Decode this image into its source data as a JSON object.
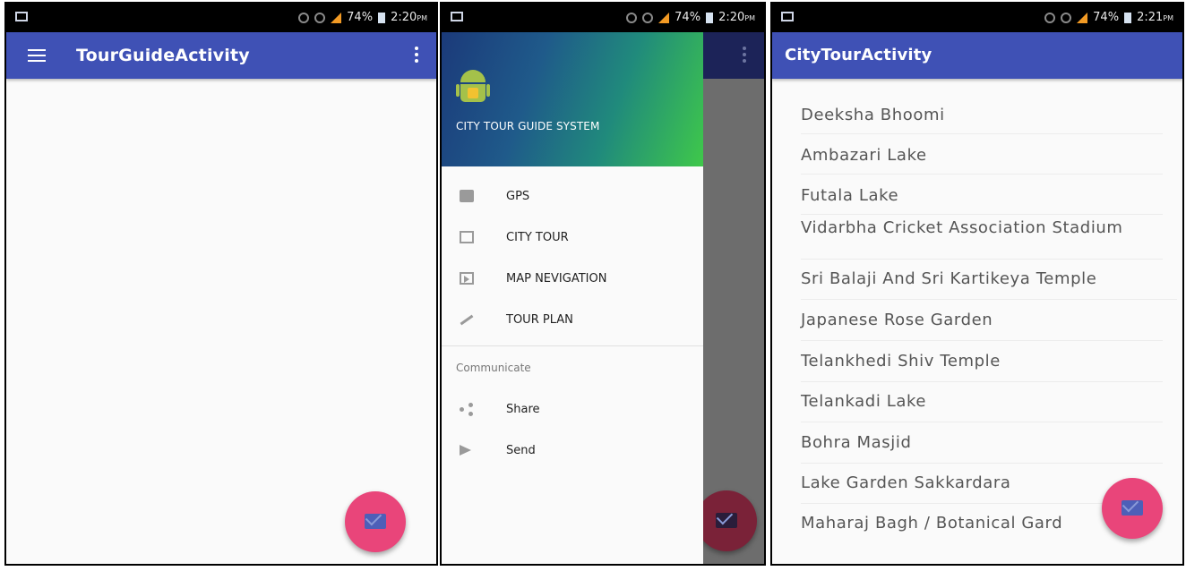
{
  "status_bar": {
    "battery": "74%",
    "time_1": "2:20",
    "time_2": "2:20",
    "time_3": "2:21",
    "ampm": "PM"
  },
  "screen1": {
    "title": "TourGuideActivity"
  },
  "screen2": {
    "drawer_title": "CITY TOUR GUIDE SYSTEM",
    "items": [
      {
        "label": "GPS",
        "icon": "camera-icon"
      },
      {
        "label": "CITY TOUR",
        "icon": "image-icon"
      },
      {
        "label": "MAP NEVIGATION",
        "icon": "slideshow-icon"
      },
      {
        "label": "TOUR PLAN",
        "icon": "wrench-icon"
      }
    ],
    "section": "Communicate",
    "comm_items": [
      {
        "label": "Share",
        "icon": "share-icon"
      },
      {
        "label": "Send",
        "icon": "send-icon"
      }
    ]
  },
  "screen3": {
    "title": "CityTourActivity",
    "places": [
      "Deeksha Bhoomi",
      "Ambazari Lake",
      "Futala Lake",
      "Vidarbha Cricket Association Stadium",
      "Sri Balaji And Sri Kartikeya Temple",
      "Japanese Rose Garden",
      "Telankhedi Shiv Temple",
      "Telankadi Lake",
      "Bohra Masjid",
      "Lake Garden Sakkardara",
      "Maharaj Bagh / Botanical Gard"
    ]
  },
  "colors": {
    "primary": "#3f51b5",
    "accent": "#e9457a"
  }
}
